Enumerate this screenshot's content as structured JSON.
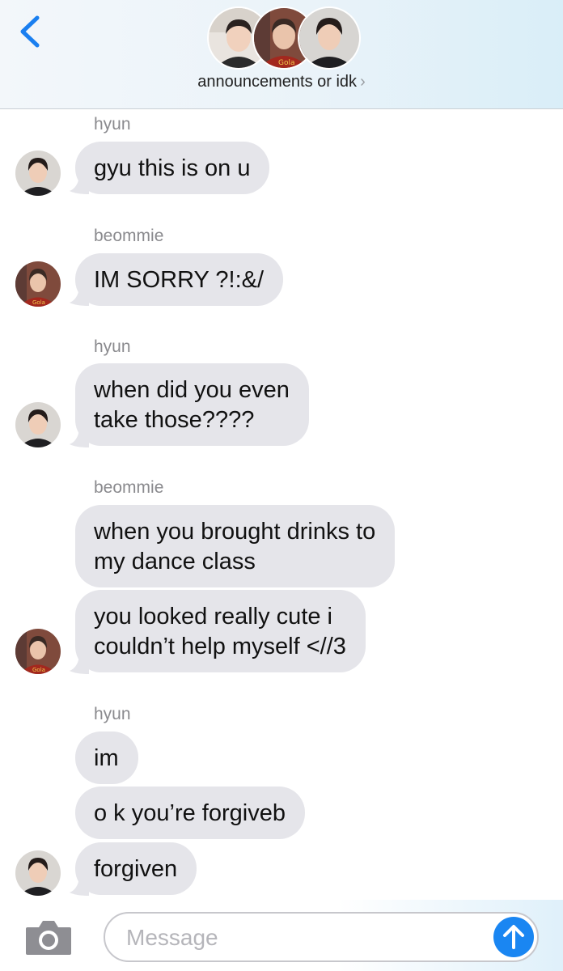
{
  "header": {
    "back_icon": "chevron-left-icon",
    "group_name": "announcements or idk",
    "chevron": "›",
    "accent_color": "#1a7ff0"
  },
  "messages": [
    {
      "sender": "hyun",
      "lines": [
        "gyu this is on u"
      ]
    },
    {
      "sender": "beommie",
      "lines": [
        "IM SORRY ?!:&/"
      ]
    },
    {
      "sender": "hyun",
      "lines": [
        "when did you even",
        "take those????"
      ]
    },
    {
      "sender": "beommie",
      "lines": [
        "when you brought drinks to",
        "my dance class"
      ]
    },
    {
      "sender": "",
      "lines": [
        "you looked really cute i",
        "couldn’t help myself <//3"
      ]
    },
    {
      "sender": "hyun",
      "lines": [
        "im"
      ]
    },
    {
      "sender": "",
      "lines": [
        "o k you’re  forgiveb"
      ]
    },
    {
      "sender": "",
      "lines": [
        "forgiven"
      ]
    }
  ],
  "composer": {
    "camera_icon": "camera-icon",
    "placeholder": "Message",
    "send_icon": "arrow-up-icon",
    "send_color": "#1a86f2"
  }
}
